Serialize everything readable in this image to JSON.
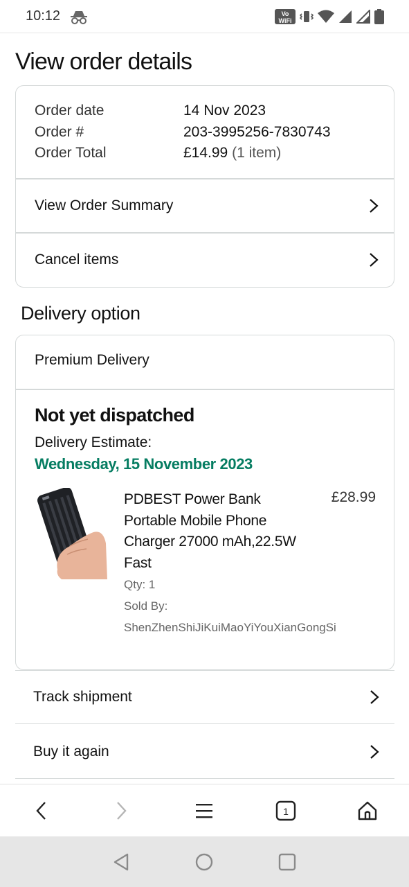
{
  "status_bar": {
    "time": "10:12",
    "volte_label": "Vo WiFi 1",
    "icons": [
      "incognito-icon",
      "vibrate-icon",
      "wifi-icon",
      "signal-icon",
      "signal-icon-2",
      "battery-icon"
    ]
  },
  "page": {
    "title": "View order details"
  },
  "order_info": {
    "rows": [
      {
        "label": "Order date",
        "value": "14 Nov 2023"
      },
      {
        "label": "Order #",
        "value": "203-3995256-7830743"
      },
      {
        "label": "Order Total",
        "value": "£14.99",
        "suffix": "(1 item)"
      }
    ],
    "links": [
      {
        "label": "View Order Summary"
      },
      {
        "label": "Cancel items"
      }
    ]
  },
  "delivery": {
    "section_title": "Delivery option",
    "option": "Premium Delivery",
    "status": "Not yet dispatched",
    "estimate_label": "Delivery Estimate:",
    "estimate_date": "Wednesday, 15 November 2023",
    "status_color": "#067D62",
    "product": {
      "name": "PDBEST Power Bank Portable Mobile Phone Charger 27000 mAh,22.5W Fast",
      "price": "£28.99",
      "qty": "Qty: 1",
      "sold_by_label": "Sold By:",
      "seller": "ShenZhenShiJiKuiMaoYiYouXianGongSi"
    }
  },
  "actions": [
    {
      "label": "Track shipment"
    },
    {
      "label": "Buy it again"
    }
  ],
  "browser_toolbar": {
    "tab_count": "1",
    "icons": [
      "back-arrow-icon",
      "forward-arrow-icon",
      "menu-icon",
      "tabs-icon",
      "home-icon"
    ]
  },
  "system_nav": {
    "icons": [
      "back-triangle-icon",
      "home-circle-icon",
      "recents-square-icon"
    ]
  }
}
